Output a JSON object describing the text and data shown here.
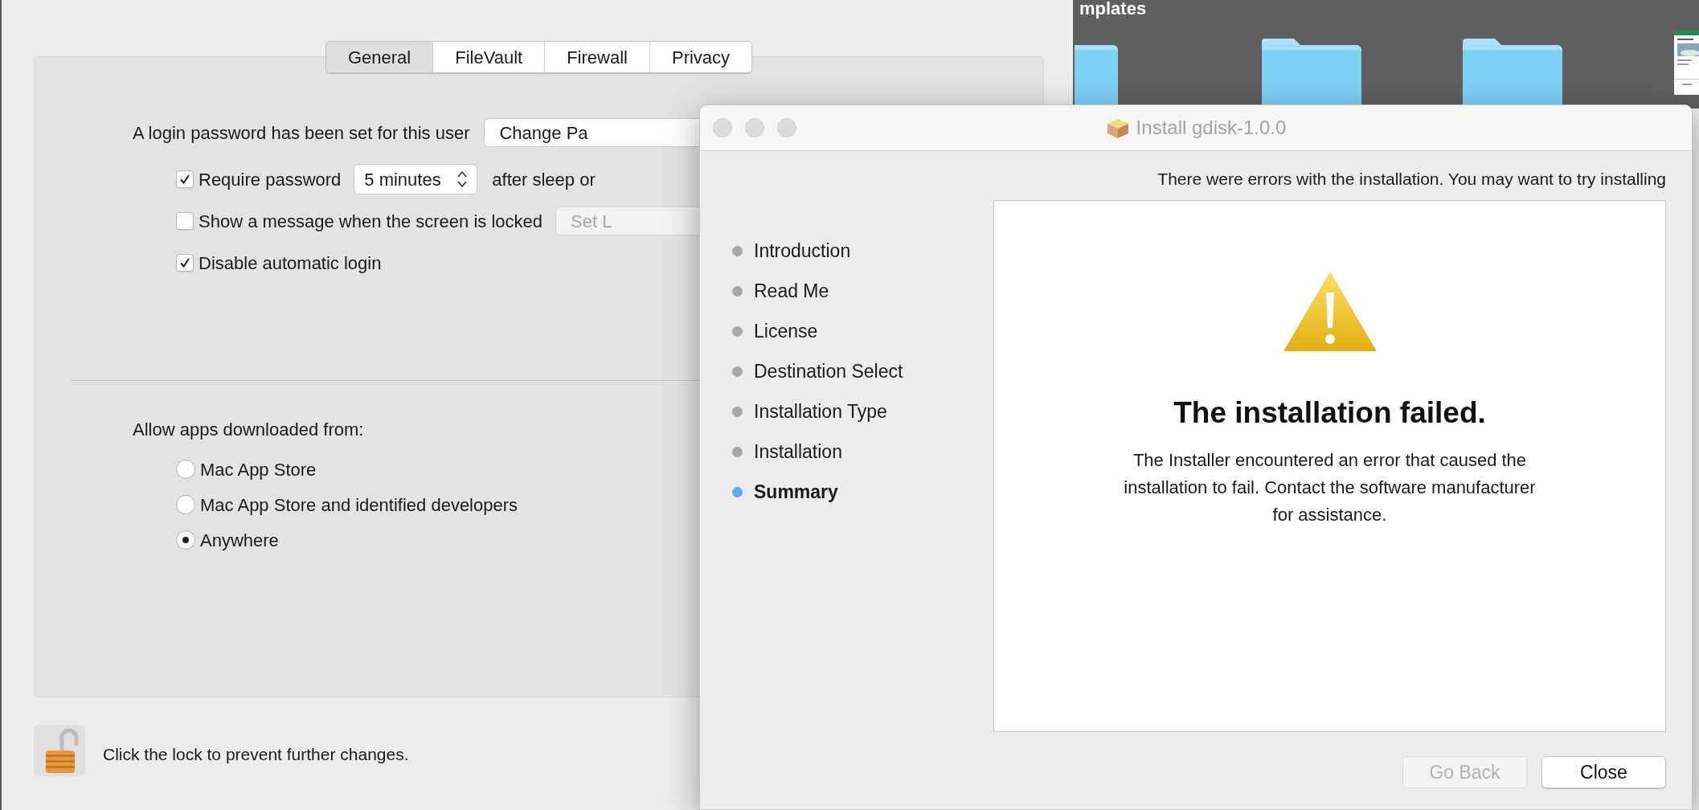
{
  "desktop": {
    "label": "mplates"
  },
  "security_window": {
    "tabs": [
      {
        "label": "General",
        "selected": true
      },
      {
        "label": "FileVault",
        "selected": false
      },
      {
        "label": "Firewall",
        "selected": false
      },
      {
        "label": "Privacy",
        "selected": false
      }
    ],
    "password": {
      "text": "A login password has been set for this user",
      "button": "Change Pa"
    },
    "checkboxes": [
      {
        "label": "Require password",
        "checked": true,
        "popup": "5 minutes",
        "trailing": "after sleep or"
      },
      {
        "label": "Show a message when the screen is locked",
        "checked": false,
        "button": "Set L"
      },
      {
        "label": "Disable automatic login",
        "checked": true
      }
    ],
    "downloads": {
      "label": "Allow apps downloaded from:",
      "options": [
        {
          "label": "Mac App Store",
          "selected": false
        },
        {
          "label": "Mac App Store and identified developers",
          "selected": false
        },
        {
          "label": "Anywhere",
          "selected": true
        }
      ]
    },
    "lock": {
      "locked": false,
      "text": "Click the lock to prevent further changes."
    }
  },
  "installer": {
    "title": "Install gdisk-1.0.0",
    "steps": [
      {
        "label": "Introduction",
        "selected": false
      },
      {
        "label": "Read Me",
        "selected": false
      },
      {
        "label": "License",
        "selected": false
      },
      {
        "label": "Destination Select",
        "selected": false
      },
      {
        "label": "Installation Type",
        "selected": false
      },
      {
        "label": "Installation",
        "selected": false
      },
      {
        "label": "Summary",
        "selected": true
      }
    ],
    "message": "There were errors with the installation. You may want to try installing",
    "heading": "The installation failed.",
    "body": "The Installer encountered an error that caused the installation to fail. Contact the software manufacturer for assistance.",
    "buttons": [
      {
        "label": "Go Back",
        "disabled": true
      },
      {
        "label": "Close",
        "disabled": false
      }
    ]
  }
}
